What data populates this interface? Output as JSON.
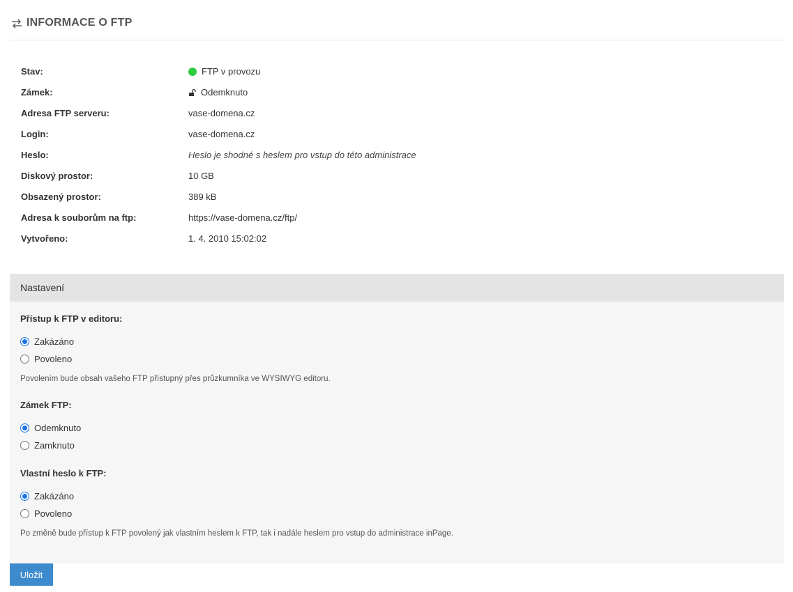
{
  "header": {
    "title": "INFORMACE O FTP",
    "icon": "transfer-arrows-icon"
  },
  "info": [
    {
      "label": "Stav:",
      "value": "FTP v provozu"
    },
    {
      "label": "Zámek:",
      "value": "Odemknuto"
    },
    {
      "label": "Adresa FTP serveru:",
      "value": "vase-domena.cz"
    },
    {
      "label": "Login:",
      "value": "vase-domena.cz"
    },
    {
      "label": "Heslo:",
      "value": "Heslo je shodné s heslem pro vstup do této administrace"
    },
    {
      "label": "Diskový prostor:",
      "value": "10 GB"
    },
    {
      "label": "Obsazený prostor:",
      "value": "389 kB"
    },
    {
      "label": "Adresa k souborům na ftp:",
      "value": "https://vase-domena.cz/ftp/"
    },
    {
      "label": "Vytvořeno:",
      "value": "1. 4. 2010 15:02:02"
    }
  ],
  "colors": {
    "status_ok": "#2ecc40",
    "accent": "#1a73e8",
    "button": "#3d8bcd"
  },
  "settings": {
    "title": "Nastavení",
    "editor_access": {
      "title": "Přístup k FTP v editoru:",
      "options": [
        "Zakázáno",
        "Povoleno"
      ],
      "selected": "Zakázáno",
      "hint": "Povolením bude obsah vašeho FTP přístupný přes průzkumníka ve WYSIWYG editoru."
    },
    "lock": {
      "title": "Zámek FTP:",
      "options": [
        "Odemknuto",
        "Zamknuto"
      ],
      "selected": "Odemknuto"
    },
    "own_password": {
      "title": "Vlastní heslo k FTP:",
      "options": [
        "Zakázáno",
        "Povoleno"
      ],
      "selected": "Zakázáno",
      "hint": "Po změně bude přístup k FTP povolený jak vlastním heslem k FTP, tak i nadále heslem pro vstup do administrace inPage."
    }
  },
  "save_label": "Uložit"
}
